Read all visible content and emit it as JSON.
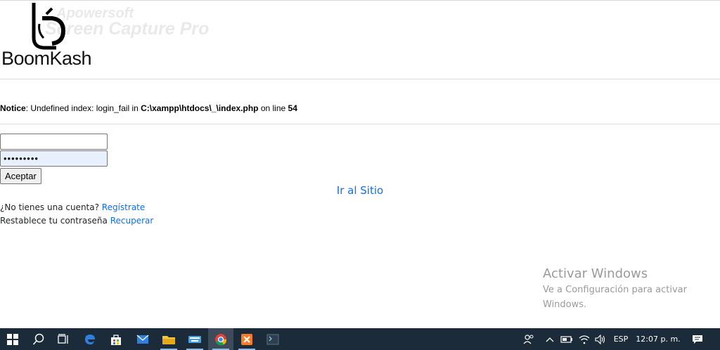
{
  "brand": {
    "name": "BoomKash",
    "watermark_line1": "Apowersoft",
    "watermark_line2": "Screen Capture Pro"
  },
  "notice": {
    "label": "Notice",
    "text1": ": Undefined index: login_fail in ",
    "path": "C:\\xampp\\htdocs\\_\\index.php",
    "text2": " on line ",
    "line": "54"
  },
  "form": {
    "username_value": "",
    "password_value": "•••••••••",
    "submit_label": "Aceptar"
  },
  "links": {
    "site_label": "Ir al Sitio",
    "register_prompt": "¿No tienes una cuenta? ",
    "register_label": "Regístrate",
    "recover_prompt": "Restablece tu contraseña ",
    "recover_label": "Recuperar"
  },
  "activation": {
    "title": "Activar Windows",
    "message": "Ve a Configuración para activar Windows."
  },
  "taskbar": {
    "language": "ESP",
    "time": "12:07 p. m.",
    "icons": [
      "windows-start-icon",
      "search-icon",
      "task-view-icon",
      "edge-icon",
      "store-icon",
      "mail-icon",
      "file-explorer-icon",
      "keyboard-app-icon",
      "chrome-icon",
      "xampp-icon",
      "terminal-app-icon"
    ]
  },
  "colors": {
    "link": "#0d6efd",
    "taskbar": "#1c2b3a",
    "autofill": "#e8f0fe"
  }
}
